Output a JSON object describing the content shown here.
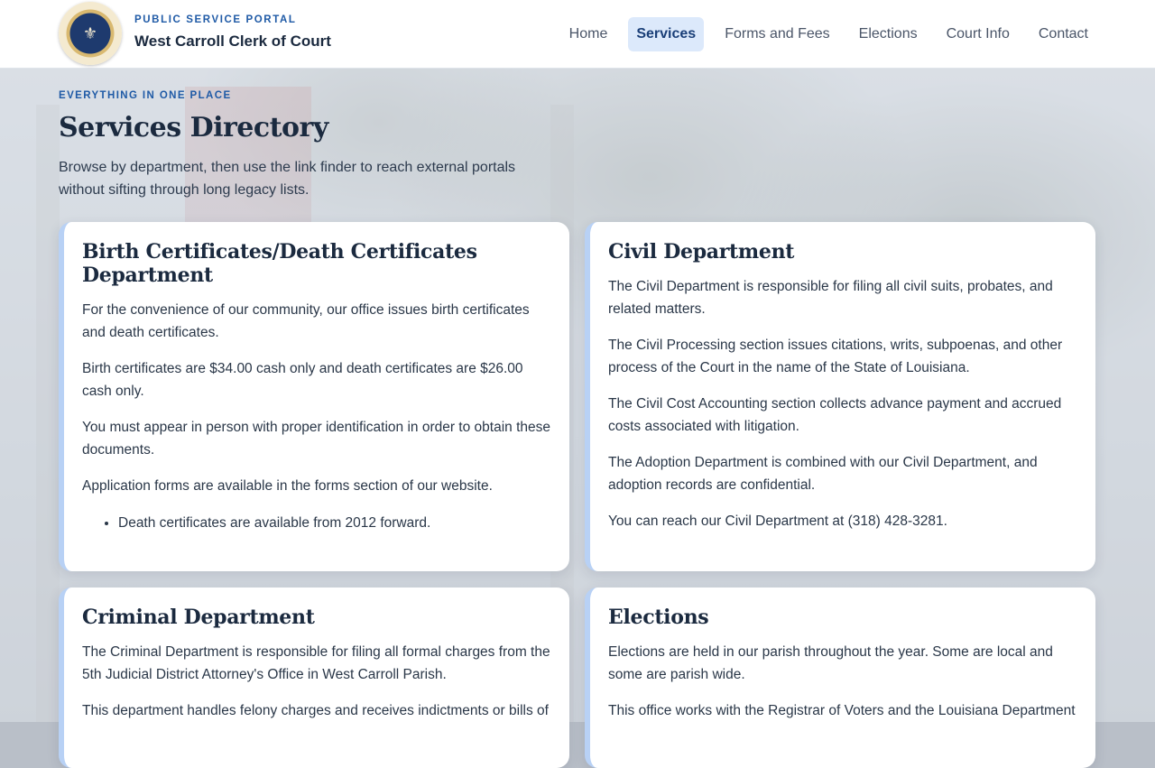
{
  "header": {
    "eyebrow": "PUBLIC SERVICE PORTAL",
    "brand": "West Carroll Clerk of Court",
    "seal_icon": "seal-icon",
    "nav": [
      {
        "label": "Home"
      },
      {
        "label": "Services",
        "active": true
      },
      {
        "label": "Forms and Fees"
      },
      {
        "label": "Elections"
      },
      {
        "label": "Court Info"
      },
      {
        "label": "Contact"
      }
    ]
  },
  "hero": {
    "eyebrow": "EVERYTHING IN ONE PLACE",
    "title": "Services Directory",
    "lede": "Browse by department, then use the link finder to reach external portals without sifting through long legacy lists."
  },
  "cards": [
    {
      "title": "Birth Certificates/Death Certificates Department",
      "paragraphs": [
        "For the convenience of our community, our office issues birth certificates and death certificates.",
        "Birth certificates are $34.00 cash only and death certificates are $26.00 cash only.",
        "You must appear in person with proper identification in order to obtain these documents.",
        "Application forms are available in the forms section of our website."
      ],
      "bullets": [
        "Death certificates are available from 2012 forward."
      ]
    },
    {
      "title": "Civil Department",
      "paragraphs": [
        "The Civil Department is responsible for filing all civil suits, probates, and related matters.",
        "The Civil Processing section issues citations, writs, subpoenas, and other process of the Court in the name of the State of Louisiana.",
        "The Civil Cost Accounting section collects advance payment and accrued costs associated with litigation.",
        "The Adoption Department is combined with our Civil Department, and adoption records are confidential.",
        "You can reach our Civil Department at (318) 428-3281."
      ]
    },
    {
      "title": "Criminal Department",
      "paragraphs": [
        "The Criminal Department is responsible for filing all formal charges from the 5th Judicial District Attorney's Office in West Carroll Parish.",
        "This department handles felony charges and receives indictments or bills of"
      ]
    },
    {
      "title": "Elections",
      "paragraphs": [
        "Elections are held in our parish throughout the year. Some are local and some are parish wide.",
        "This office works with the Registrar of Voters and the Louisiana Department"
      ]
    }
  ]
}
